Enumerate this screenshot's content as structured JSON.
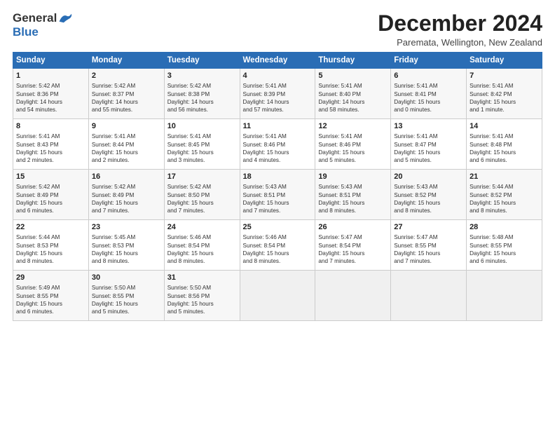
{
  "logo": {
    "general": "General",
    "blue": "Blue"
  },
  "title": "December 2024",
  "subtitle": "Paremata, Wellington, New Zealand",
  "days_of_week": [
    "Sunday",
    "Monday",
    "Tuesday",
    "Wednesday",
    "Thursday",
    "Friday",
    "Saturday"
  ],
  "weeks": [
    [
      {
        "day": "1",
        "detail": "Sunrise: 5:42 AM\nSunset: 8:36 PM\nDaylight: 14 hours\nand 54 minutes."
      },
      {
        "day": "2",
        "detail": "Sunrise: 5:42 AM\nSunset: 8:37 PM\nDaylight: 14 hours\nand 55 minutes."
      },
      {
        "day": "3",
        "detail": "Sunrise: 5:42 AM\nSunset: 8:38 PM\nDaylight: 14 hours\nand 56 minutes."
      },
      {
        "day": "4",
        "detail": "Sunrise: 5:41 AM\nSunset: 8:39 PM\nDaylight: 14 hours\nand 57 minutes."
      },
      {
        "day": "5",
        "detail": "Sunrise: 5:41 AM\nSunset: 8:40 PM\nDaylight: 14 hours\nand 58 minutes."
      },
      {
        "day": "6",
        "detail": "Sunrise: 5:41 AM\nSunset: 8:41 PM\nDaylight: 15 hours\nand 0 minutes."
      },
      {
        "day": "7",
        "detail": "Sunrise: 5:41 AM\nSunset: 8:42 PM\nDaylight: 15 hours\nand 1 minute."
      }
    ],
    [
      {
        "day": "8",
        "detail": "Sunrise: 5:41 AM\nSunset: 8:43 PM\nDaylight: 15 hours\nand 2 minutes."
      },
      {
        "day": "9",
        "detail": "Sunrise: 5:41 AM\nSunset: 8:44 PM\nDaylight: 15 hours\nand 2 minutes."
      },
      {
        "day": "10",
        "detail": "Sunrise: 5:41 AM\nSunset: 8:45 PM\nDaylight: 15 hours\nand 3 minutes."
      },
      {
        "day": "11",
        "detail": "Sunrise: 5:41 AM\nSunset: 8:46 PM\nDaylight: 15 hours\nand 4 minutes."
      },
      {
        "day": "12",
        "detail": "Sunrise: 5:41 AM\nSunset: 8:46 PM\nDaylight: 15 hours\nand 5 minutes."
      },
      {
        "day": "13",
        "detail": "Sunrise: 5:41 AM\nSunset: 8:47 PM\nDaylight: 15 hours\nand 5 minutes."
      },
      {
        "day": "14",
        "detail": "Sunrise: 5:41 AM\nSunset: 8:48 PM\nDaylight: 15 hours\nand 6 minutes."
      }
    ],
    [
      {
        "day": "15",
        "detail": "Sunrise: 5:42 AM\nSunset: 8:49 PM\nDaylight: 15 hours\nand 6 minutes."
      },
      {
        "day": "16",
        "detail": "Sunrise: 5:42 AM\nSunset: 8:49 PM\nDaylight: 15 hours\nand 7 minutes."
      },
      {
        "day": "17",
        "detail": "Sunrise: 5:42 AM\nSunset: 8:50 PM\nDaylight: 15 hours\nand 7 minutes."
      },
      {
        "day": "18",
        "detail": "Sunrise: 5:43 AM\nSunset: 8:51 PM\nDaylight: 15 hours\nand 7 minutes."
      },
      {
        "day": "19",
        "detail": "Sunrise: 5:43 AM\nSunset: 8:51 PM\nDaylight: 15 hours\nand 8 minutes."
      },
      {
        "day": "20",
        "detail": "Sunrise: 5:43 AM\nSunset: 8:52 PM\nDaylight: 15 hours\nand 8 minutes."
      },
      {
        "day": "21",
        "detail": "Sunrise: 5:44 AM\nSunset: 8:52 PM\nDaylight: 15 hours\nand 8 minutes."
      }
    ],
    [
      {
        "day": "22",
        "detail": "Sunrise: 5:44 AM\nSunset: 8:53 PM\nDaylight: 15 hours\nand 8 minutes."
      },
      {
        "day": "23",
        "detail": "Sunrise: 5:45 AM\nSunset: 8:53 PM\nDaylight: 15 hours\nand 8 minutes."
      },
      {
        "day": "24",
        "detail": "Sunrise: 5:46 AM\nSunset: 8:54 PM\nDaylight: 15 hours\nand 8 minutes."
      },
      {
        "day": "25",
        "detail": "Sunrise: 5:46 AM\nSunset: 8:54 PM\nDaylight: 15 hours\nand 8 minutes."
      },
      {
        "day": "26",
        "detail": "Sunrise: 5:47 AM\nSunset: 8:54 PM\nDaylight: 15 hours\nand 7 minutes."
      },
      {
        "day": "27",
        "detail": "Sunrise: 5:47 AM\nSunset: 8:55 PM\nDaylight: 15 hours\nand 7 minutes."
      },
      {
        "day": "28",
        "detail": "Sunrise: 5:48 AM\nSunset: 8:55 PM\nDaylight: 15 hours\nand 6 minutes."
      }
    ],
    [
      {
        "day": "29",
        "detail": "Sunrise: 5:49 AM\nSunset: 8:55 PM\nDaylight: 15 hours\nand 6 minutes."
      },
      {
        "day": "30",
        "detail": "Sunrise: 5:50 AM\nSunset: 8:55 PM\nDaylight: 15 hours\nand 5 minutes."
      },
      {
        "day": "31",
        "detail": "Sunrise: 5:50 AM\nSunset: 8:56 PM\nDaylight: 15 hours\nand 5 minutes."
      },
      {
        "day": "",
        "detail": ""
      },
      {
        "day": "",
        "detail": ""
      },
      {
        "day": "",
        "detail": ""
      },
      {
        "day": "",
        "detail": ""
      }
    ]
  ]
}
